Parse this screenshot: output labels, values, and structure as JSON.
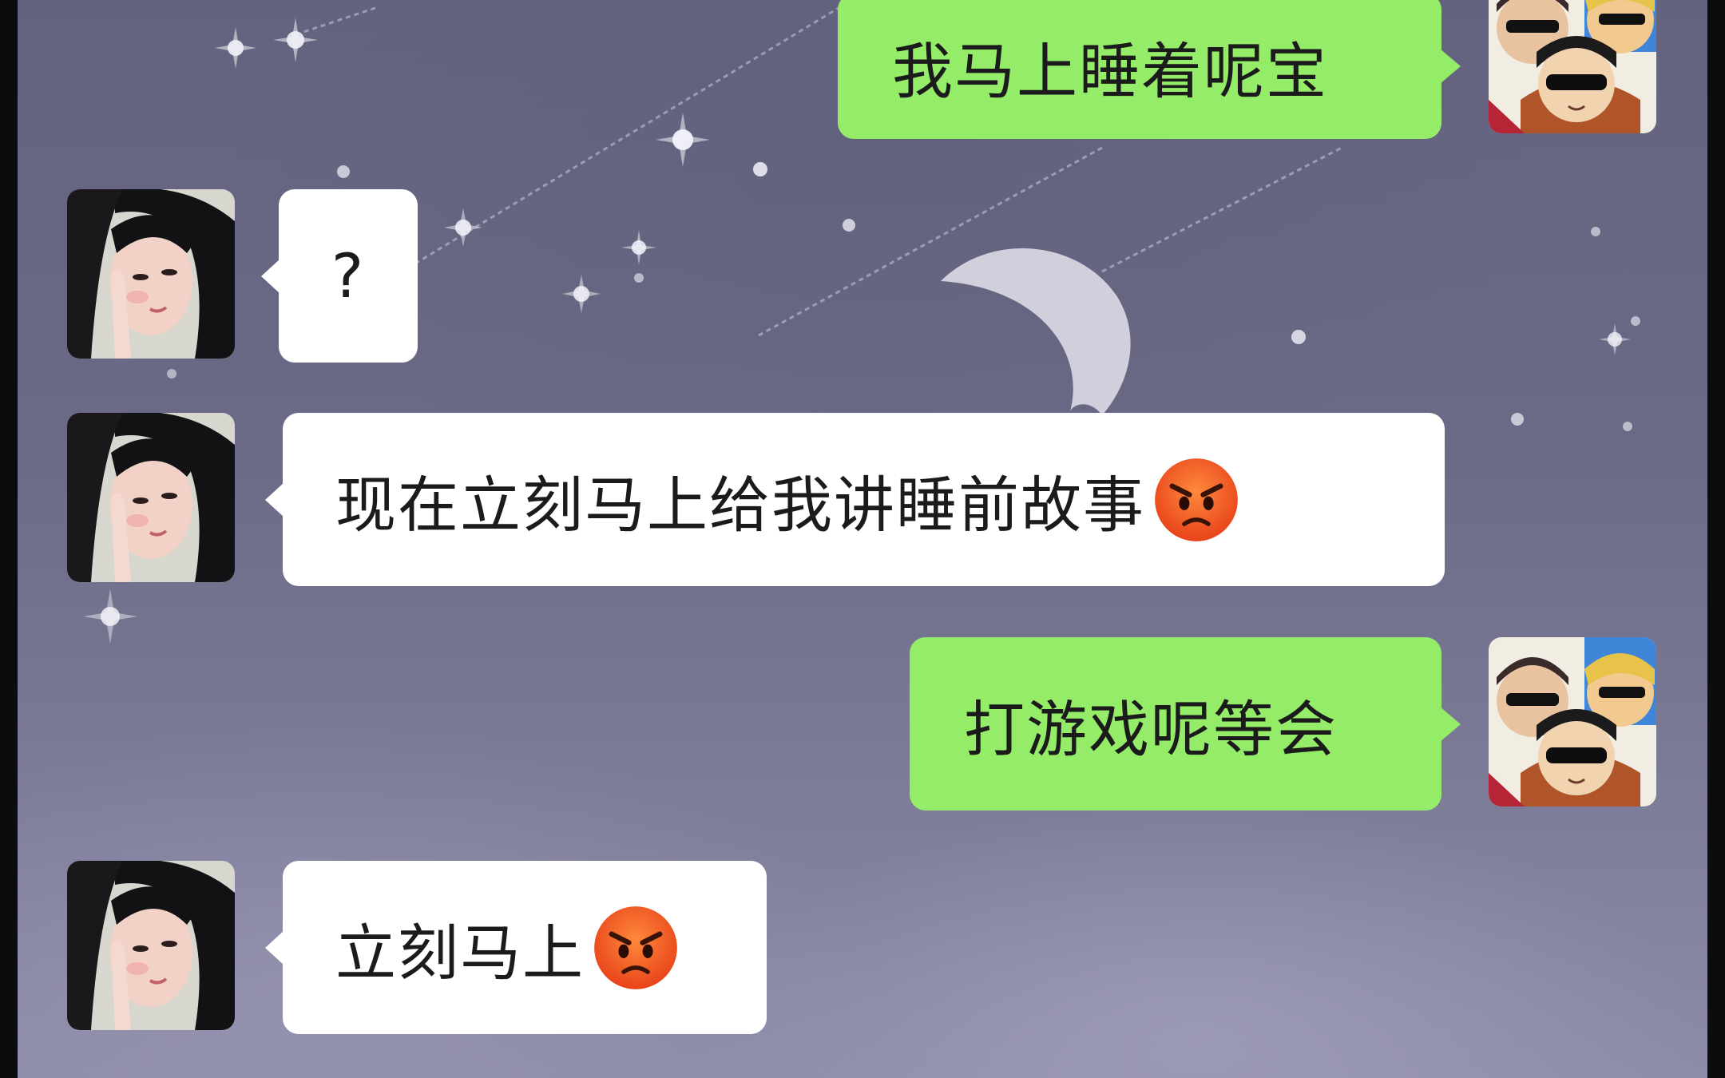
{
  "chat": {
    "messages": [
      {
        "sender": "me",
        "text": "我马上睡着呢宝",
        "emoji": ""
      },
      {
        "sender": "contact",
        "text": "?",
        "emoji": ""
      },
      {
        "sender": "contact",
        "text": "现在立刻马上给我讲睡前故事",
        "emoji": "angry-face-emoji"
      },
      {
        "sender": "me",
        "text": "打游戏呢等会",
        "emoji": ""
      },
      {
        "sender": "contact",
        "text": "立刻马上",
        "emoji": "angry-face-emoji"
      }
    ]
  },
  "colors": {
    "outgoing_bubble": "#95ec69",
    "incoming_bubble": "#ffffff",
    "background": "#6a6a86",
    "angry_emoji": "#ef5a1f"
  },
  "icons": {
    "contact_avatar": "girl-photo-avatar",
    "my_avatar": "cartoon-sunglasses-trio-avatar",
    "background_art": "night-sky-moon-stars"
  }
}
